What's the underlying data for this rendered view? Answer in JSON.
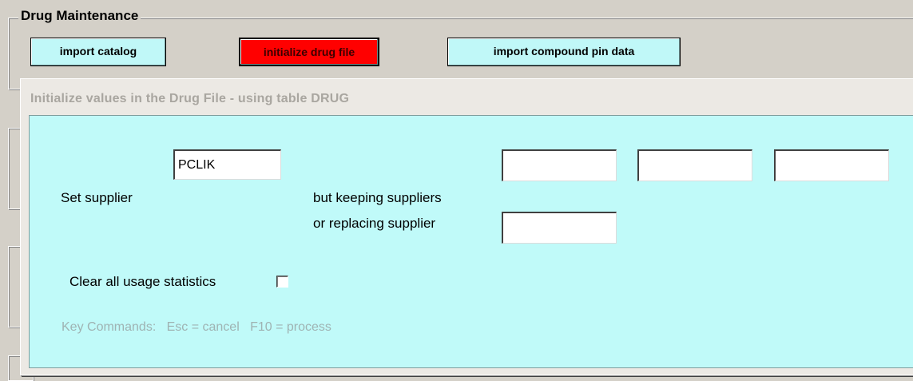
{
  "group": {
    "title": "Drug Maintenance"
  },
  "toolbar": {
    "import_catalog": "import catalog",
    "initialize_drug_file": "initialize drug file",
    "import_compound_pin": "import compound pin data"
  },
  "dialog": {
    "title": "Initialize values in the Drug File - using table DRUG",
    "set_supplier_label": "Set supplier",
    "set_supplier_value": "PCLIK",
    "keeping_suppliers_label": "but keeping suppliers",
    "keeping_suppliers_values": [
      "",
      "",
      ""
    ],
    "replacing_supplier_label": "or replacing supplier",
    "replacing_supplier_value": "",
    "clear_stats_label": "Clear all usage statistics",
    "clear_stats_checked": false,
    "key_commands": "Key Commands:   Esc = cancel   F10 = process"
  },
  "colors": {
    "dialog_body": "#c0faf9",
    "button_face": "#c0f8f8",
    "danger_button": "#ff0000"
  }
}
